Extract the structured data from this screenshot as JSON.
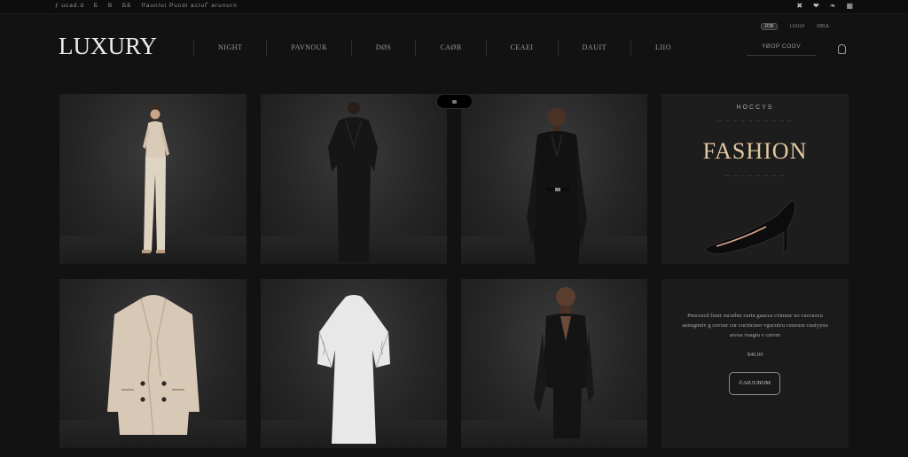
{
  "topbar": {
    "left_items": [
      "ƒ ucad.d",
      "Б",
      "В",
      "ББ",
      "ffaunlui Pucdi aciuЃ arunurn"
    ],
    "social_icons": [
      "x-icon",
      "heart-icon",
      "pin-icon",
      "grid-icon"
    ],
    "social_glyphs": [
      "✖",
      "❤",
      "❧",
      "▦"
    ]
  },
  "header": {
    "logo": "LUXURY",
    "nav": [
      "NIGHT",
      "PAVNOUR",
      "DØS",
      "CAØB",
      "CEAEI",
      "DAUIT",
      "LIIO"
    ],
    "util": {
      "pill": "JOB",
      "links": [
        "LUUUI",
        "OBUL"
      ]
    },
    "search_placeholder": "YØOP COOV"
  },
  "promo": {
    "kicker": "HOCCYS",
    "sub1": "— — — — — — — — — —",
    "title": "FASHION",
    "sub2": "— — — — — — — —"
  },
  "info": {
    "description": "Pnocrucd fuutr rucuilnz curin guacca cvinuuc uo cuccuocu aunugnuiv g cuvuur cur cucincuoo vgucuicu cuuouur cuuiyyuu arvuu vuagiu v curvm",
    "price": "$40.00",
    "cta": "©AIUUBOM"
  },
  "colors": {
    "background": "#121212",
    "accent": "#e2c9a2",
    "text": "#cfcfcf"
  }
}
